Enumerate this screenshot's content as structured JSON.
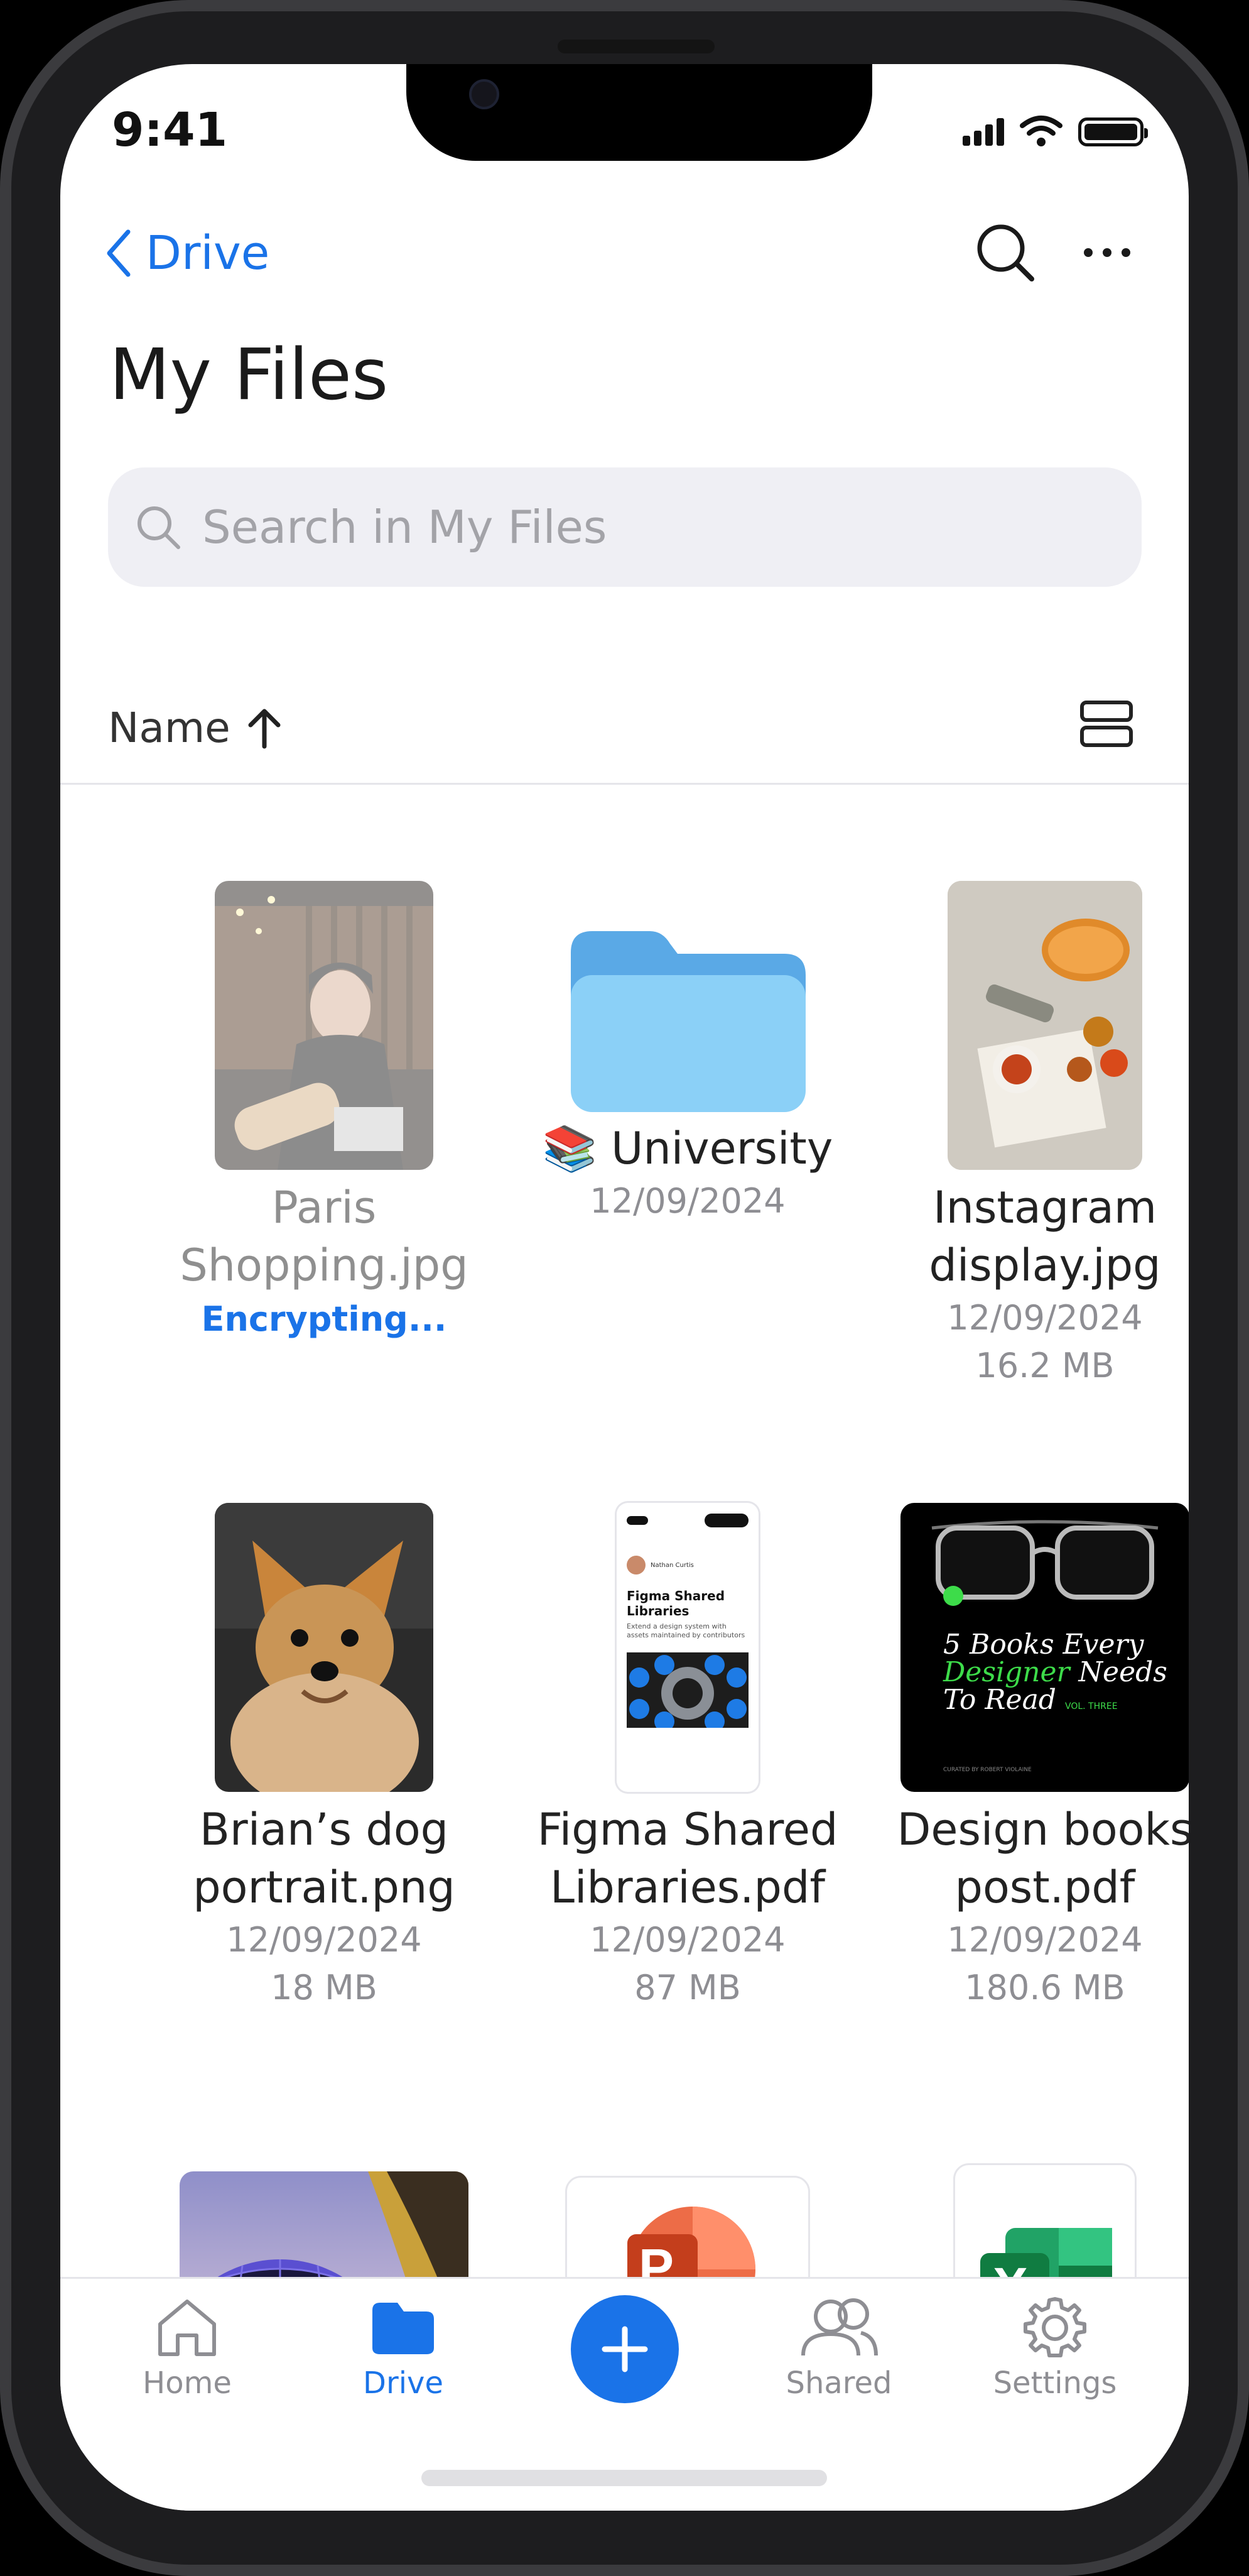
{
  "status": {
    "time": "9:41"
  },
  "nav": {
    "back_label": "Drive",
    "title": "My Files"
  },
  "search": {
    "placeholder": "Search in My Files"
  },
  "sort": {
    "label": "Name"
  },
  "files": [
    {
      "name": "Paris Shopping.jpg",
      "status": "Encrypting..."
    },
    {
      "name": "University",
      "emoji": "📚",
      "date": "12/09/2024"
    },
    {
      "name": "Instagram display.jpg",
      "date": "12/09/2024",
      "size": "16.2 MB"
    },
    {
      "name": "Brian’s dog portrait.png",
      "date": "12/09/2024",
      "size": "18 MB"
    },
    {
      "name": "Figma Shared Libraries.pdf",
      "date": "12/09/2024",
      "size": "87 MB"
    },
    {
      "name": "Design books post.pdf",
      "date": "12/09/2024",
      "size": "180.6 MB"
    }
  ],
  "pdf_preview": {
    "title": "Figma Shared Libraries",
    "author": "Nathan Curtis",
    "subtitle": "Extend a design system with assets maintained by contributors"
  },
  "book_cover": {
    "line1": "5 Books Every",
    "line2_accent": "Designer",
    "line2_rest": " Needs",
    "line3": "To Read",
    "vol": "VOL. THREE",
    "credit": "CURATED BY ROBERT VIOLAINE"
  },
  "office_icons": {
    "powerpoint_letter": "P",
    "excel_letter": "X"
  },
  "colors": {
    "accent": "#1a73e8",
    "folder_top": "#5aa9e6",
    "folder_front": "#8bd0f7",
    "book_accent": "#3ddc4a"
  },
  "tabs": [
    {
      "label": "Home",
      "icon": "home-icon"
    },
    {
      "label": "Drive",
      "icon": "folder-icon",
      "active": true
    },
    {
      "label": "Shared",
      "icon": "people-icon"
    },
    {
      "label": "Settings",
      "icon": "gear-icon"
    }
  ]
}
